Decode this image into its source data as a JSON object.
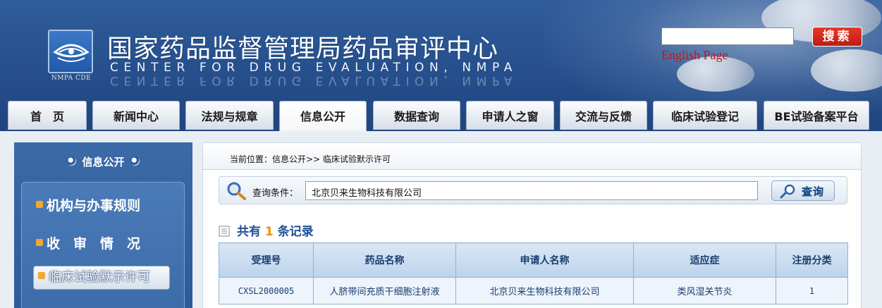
{
  "header": {
    "logo_caption": "NMPA CDE",
    "title_cn": "国家药品监督管理局药品审评中心",
    "title_en": "CENTER  FOR  DRUG  EVALUATION,  NMPA",
    "search_button": "搜索",
    "search_value": "",
    "english_link": "English Page"
  },
  "nav": {
    "tabs": [
      {
        "label": "首　页"
      },
      {
        "label": "新闻中心"
      },
      {
        "label": "法规与规章"
      },
      {
        "label": "信息公开"
      },
      {
        "label": "数据查询"
      },
      {
        "label": "申请人之窗"
      },
      {
        "label": "交流与反馈"
      },
      {
        "label": "临床试验登记"
      },
      {
        "label": "BE试验备案平台"
      }
    ],
    "active_tab": "信息公开"
  },
  "sidebar": {
    "title": "信息公开",
    "items": [
      {
        "label": "机构与办事规则"
      },
      {
        "label": "收　审　情　况"
      },
      {
        "label": "临床试验默示许可"
      }
    ],
    "active_item": "临床试验默示许可"
  },
  "main": {
    "breadcrumb": "当前位置：信息公开>> 临床试验默示许可",
    "query_label": "查询条件：",
    "query_value": "北京贝来生物科技有限公司",
    "query_button": "查询",
    "record_prefix": "共有",
    "record_count": "1",
    "record_suffix": "条记录",
    "table": {
      "headers": [
        "受理号",
        "药品名称",
        "申请人名称",
        "适应症",
        "注册分类"
      ],
      "rows": [
        [
          "CXSL2000005",
          "人脐带间充质干细胞注射液",
          "北京贝来生物科技有限公司",
          "类风湿关节炎",
          "1"
        ]
      ]
    }
  },
  "colors": {
    "header_blue": "#2a5592",
    "search_red": "#d0281c",
    "link_red": "#c0161a",
    "table_text": "#1a3d6d",
    "count_orange": "#f08c00"
  }
}
